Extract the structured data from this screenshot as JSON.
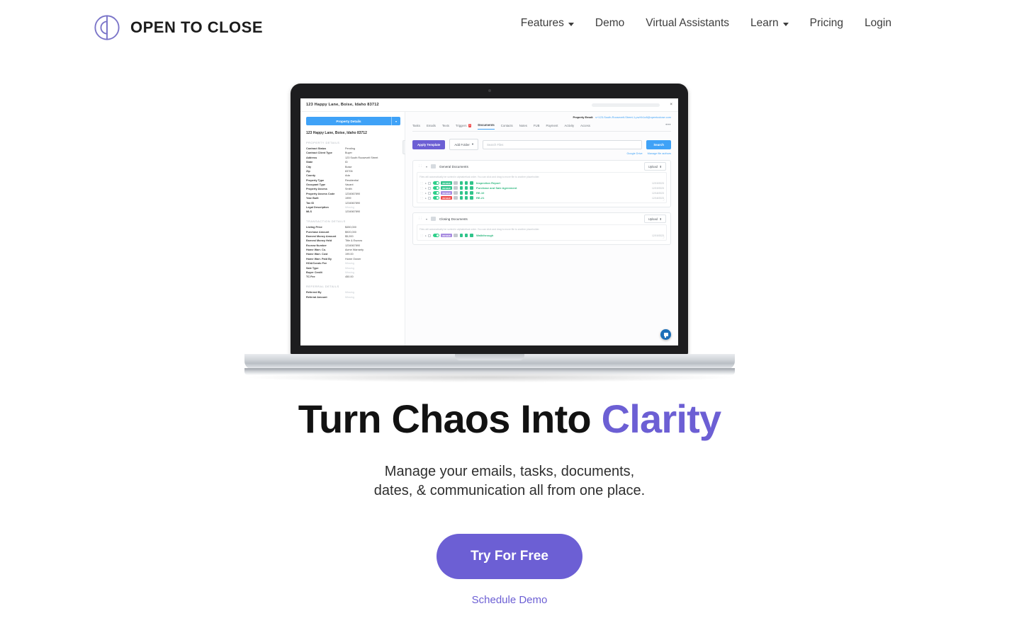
{
  "header": {
    "brand": {
      "name": "OPEN TO CLOSE",
      "logo_icon": "open-to-close-circle-logo",
      "color": "#7b75c9"
    },
    "nav": [
      {
        "label": "Features",
        "has_dropdown": true
      },
      {
        "label": "Demo",
        "has_dropdown": false
      },
      {
        "label": "Virtual Assistants",
        "has_dropdown": false
      },
      {
        "label": "Learn",
        "has_dropdown": true
      },
      {
        "label": "Pricing",
        "has_dropdown": false
      },
      {
        "label": "Login",
        "has_dropdown": false
      }
    ]
  },
  "screenshot_app": {
    "window_title": "123 Happy Lane, Boise, Idaho 83712",
    "close_label": "×",
    "sidebar": {
      "button_label": "Property Details",
      "button_caret": "▾",
      "address": "123 Happy Lane, Boise, Idaho 83712",
      "sections": [
        {
          "title": "PROPERTY DETAILS",
          "fields": [
            {
              "label": "Contract Status",
              "value": "Pending"
            },
            {
              "label": "Contract Client Type",
              "value": "Buyer"
            },
            {
              "label": "Address",
              "value": "123 South Roosevelt Street"
            },
            {
              "label": "State",
              "value": "ID"
            },
            {
              "label": "City",
              "value": "Boise"
            },
            {
              "label": "Zip",
              "value": "83706"
            },
            {
              "label": "County",
              "value": "Ada"
            },
            {
              "label": "Property Type",
              "value": "Residential"
            },
            {
              "label": "Occupant Type",
              "value": "Vacant"
            },
            {
              "label": "Property Assess",
              "value": "Smith"
            },
            {
              "label": "Property Assess Code",
              "value": "1234567890"
            },
            {
              "label": "Year Built",
              "value": "1999"
            },
            {
              "label": "Tax ID",
              "value": "1234567890"
            },
            {
              "label": "Legal Description",
              "value": "Missing",
              "muted": true
            },
            {
              "label": "MLS",
              "value": "1234567890"
            }
          ]
        },
        {
          "title": "TRANSACTION DETAILS",
          "fields": [
            {
              "label": "Listing Price",
              "value": "$450,000"
            },
            {
              "label": "Purchase Amount",
              "value": "$920,000"
            },
            {
              "label": "Earnest Money Amount",
              "value": "$5,000"
            },
            {
              "label": "Earnest Money Held",
              "value": "Title & Escrow"
            },
            {
              "label": "Escrow Number",
              "value": "1234567890"
            },
            {
              "label": "Home Warr. Co.",
              "value": "Acme Warranty"
            },
            {
              "label": "Home Warr. Cost",
              "value": "199.00"
            },
            {
              "label": "Home Warr. Paid By",
              "value": "Home Owner"
            },
            {
              "label": "HOA/Condo Fee",
              "value": "Missing",
              "muted": true
            },
            {
              "label": "Sale Type",
              "value": "Missing",
              "muted": true
            },
            {
              "label": "Buyer Credit",
              "value": "Missing",
              "muted": true
            },
            {
              "label": "TC Fee",
              "value": "450.00"
            }
          ]
        },
        {
          "title": "REFERRAL DETAILS",
          "fields": [
            {
              "label": "Referred By",
              "value": "Missing",
              "muted": true
            },
            {
              "label": "Referral Amount",
              "value": "Missing",
              "muted": true
            }
          ]
        }
      ]
    },
    "main": {
      "property_email_label": "Property Email:",
      "property_email_value": "s+123-South-Roosevelt-Street-1-pwXh1o8@opentoclose.com",
      "tabs": [
        {
          "label": "Tasks",
          "active": false
        },
        {
          "label": "Emails",
          "active": false
        },
        {
          "label": "Texts",
          "active": false
        },
        {
          "label": "Triggers",
          "active": false,
          "badge": "3"
        },
        {
          "label": "Documents",
          "active": true
        },
        {
          "label": "Contacts",
          "active": false
        },
        {
          "label": "Notes",
          "active": false
        },
        {
          "label": "FUB",
          "active": false
        },
        {
          "label": "Payment",
          "active": false
        },
        {
          "label": "Activity",
          "active": false
        },
        {
          "label": "Access",
          "active": false
        }
      ],
      "tab_more": "•••",
      "toolbar": {
        "apply_template_label": "Apply Template",
        "add_folder_label": "Add Folder",
        "add_folder_caret": "▾",
        "search_placeholder": "Search Files",
        "search_button_label": "Search"
      },
      "util_links": [
        "Google Drive",
        "Manage file authors"
      ],
      "folder_hint": "Files will automatically be sorted in alphabetical order. You can click and drag to move file to another placeholder.",
      "folders": [
        {
          "name": "General Documents",
          "upload_label": "Upload",
          "files": [
            {
              "name": "Inspection Report",
              "status": "REVIEW",
              "status_color": "#2fc48a",
              "date": "12/19/2023"
            },
            {
              "name": "Purchase and Sale Agreement",
              "status": "REVIEW",
              "status_color": "#2fc48a",
              "date": "12/19/2023"
            },
            {
              "name": "RE-10",
              "status": "REVIEW",
              "status_color": "#a78be0",
              "date": "12/18/2023"
            },
            {
              "name": "RE-21",
              "status": "REVIEW",
              "status_color": "#ef4b4b",
              "date": "12/18/2023"
            }
          ]
        },
        {
          "name": "Closing Documents",
          "upload_label": "Upload",
          "files": [
            {
              "name": "Walkthrough",
              "status": "REVIEW",
              "status_color": "#a78be0",
              "date": "12/19/2023"
            }
          ]
        }
      ],
      "chat_widget_icon": "chat-bubble-icon"
    }
  },
  "hero": {
    "title_main": "Turn Chaos Into ",
    "title_accent": "Clarity",
    "subtitle_line1": "Manage your emails, tasks, documents,",
    "subtitle_line2": "dates, & communication all from one place.",
    "cta_button": "Try For Free",
    "cta_link": "Schedule Demo",
    "accent_color": "#6c5fd4"
  }
}
